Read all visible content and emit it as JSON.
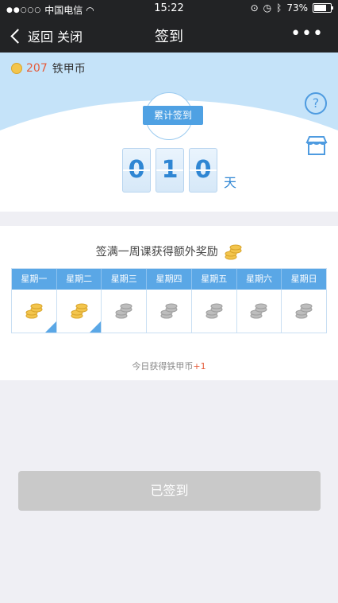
{
  "statusbar": {
    "carrier": "中国电信",
    "time": "15:22",
    "battery": "73%"
  },
  "nav": {
    "back": "返回",
    "close": "关闭",
    "title": "签到",
    "more": "•••"
  },
  "balance": {
    "count": "207",
    "label": "铁甲币"
  },
  "total": {
    "badge": "累计签到",
    "digits": [
      "0",
      "1",
      "0"
    ],
    "unit": "天"
  },
  "weekly": {
    "title": "签满一周课获得额外奖励",
    "days": [
      "星期一",
      "星期二",
      "星期三",
      "星期四",
      "星期五",
      "星期六",
      "星期日"
    ],
    "signed": [
      true,
      true,
      false,
      false,
      false,
      false,
      false
    ]
  },
  "today": {
    "prefix": "今日获得铁甲币",
    "amount": "+1"
  },
  "button": {
    "label": "已签到"
  },
  "colors": {
    "accent": "#5aa7e6",
    "coin_gold": "#f3c54d",
    "coin_grey": "#bdbdbd",
    "highlight": "#e55c3b"
  }
}
